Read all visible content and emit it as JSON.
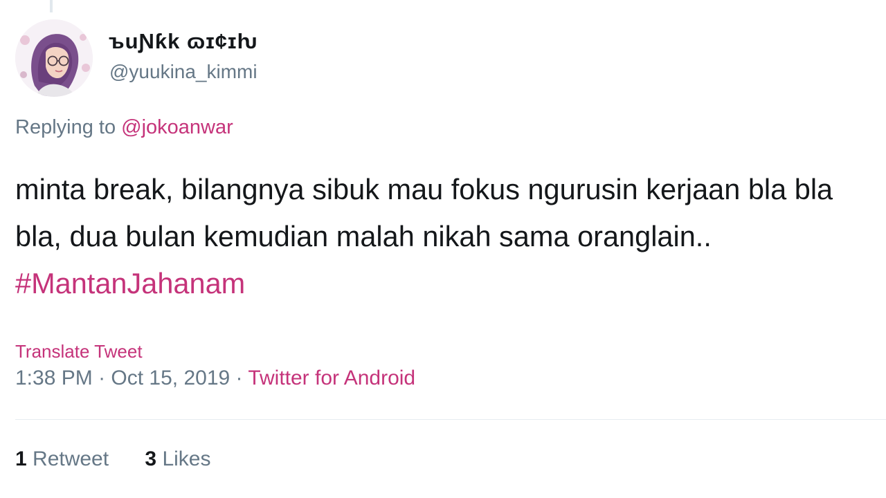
{
  "author": {
    "display_name": "ъuƝƙk ɷɪ¢ɪƕ",
    "handle": "@yuukina_kimmi",
    "avatar_icon": "hijab-girl-avatar-icon"
  },
  "reply": {
    "prefix": "Replying to ",
    "mention": "@jokoanwar"
  },
  "body": {
    "text": "minta break, bilangnya sibuk mau fokus ngurusin kerjaan bla bla bla, dua bulan kemudian malah nikah sama oranglain.. ",
    "hashtag": "#MantanJahanam"
  },
  "translate_label": "Translate Tweet",
  "meta": {
    "time": "1:38 PM",
    "separator1": " · ",
    "date": "Oct 15, 2019",
    "separator2": " · ",
    "source": "Twitter for Android"
  },
  "stats": {
    "retweets_count": "1",
    "retweets_label": " Retweet",
    "likes_count": "3",
    "likes_label": " Likes"
  },
  "colors": {
    "accent": "#c5337a",
    "text": "#14171a",
    "muted": "#657786"
  }
}
